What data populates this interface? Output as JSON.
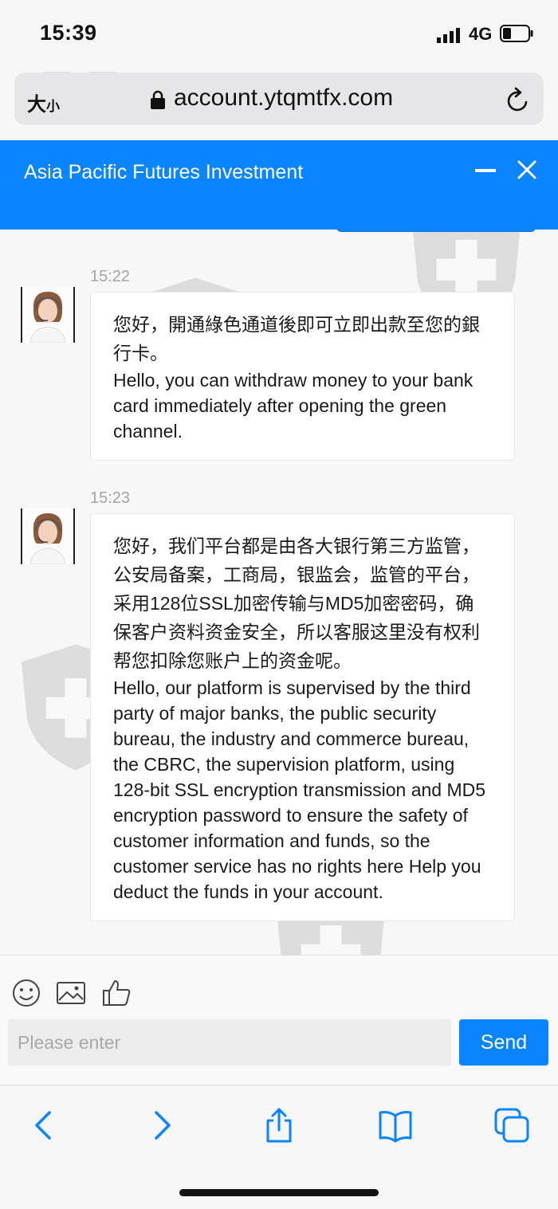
{
  "status_bar": {
    "time": "15:39",
    "network": "4G"
  },
  "browser": {
    "text_size_label": "大",
    "text_size_small": "小",
    "url": "account.ytqmtfx.com"
  },
  "chat_header": {
    "title": "Asia Pacific Futures Investment"
  },
  "messages": [
    {
      "time": "15:22",
      "zh": "您好，開通綠色通道後即可立即出款至您的銀行卡。",
      "en": "Hello, you can withdraw money to your bank card immediately after opening the green channel."
    },
    {
      "time": "15:23",
      "zh": "您好，我们平台都是由各大银行第三方监管，公安局备案，工商局，银监会，监管的平台，采用128位SSL加密传输与MD5加密密码，确保客户资料资金安全，所以客服这里没有权利帮您扣除您账户上的资金呢。",
      "en": "Hello, our platform is supervised by the third party of major banks, the public security bureau, the industry and commerce bureau, the CBRC, the supervision platform, using 128-bit SSL encryption transmission and MD5 encryption password to ensure the safety of customer information and funds, so the customer service has no rights here Help you deduct the funds in your account."
    }
  ],
  "composer": {
    "placeholder": "Please enter",
    "send_label": "Send"
  },
  "colors": {
    "accent": "#0a84ff",
    "background": "#f7f7f7"
  }
}
